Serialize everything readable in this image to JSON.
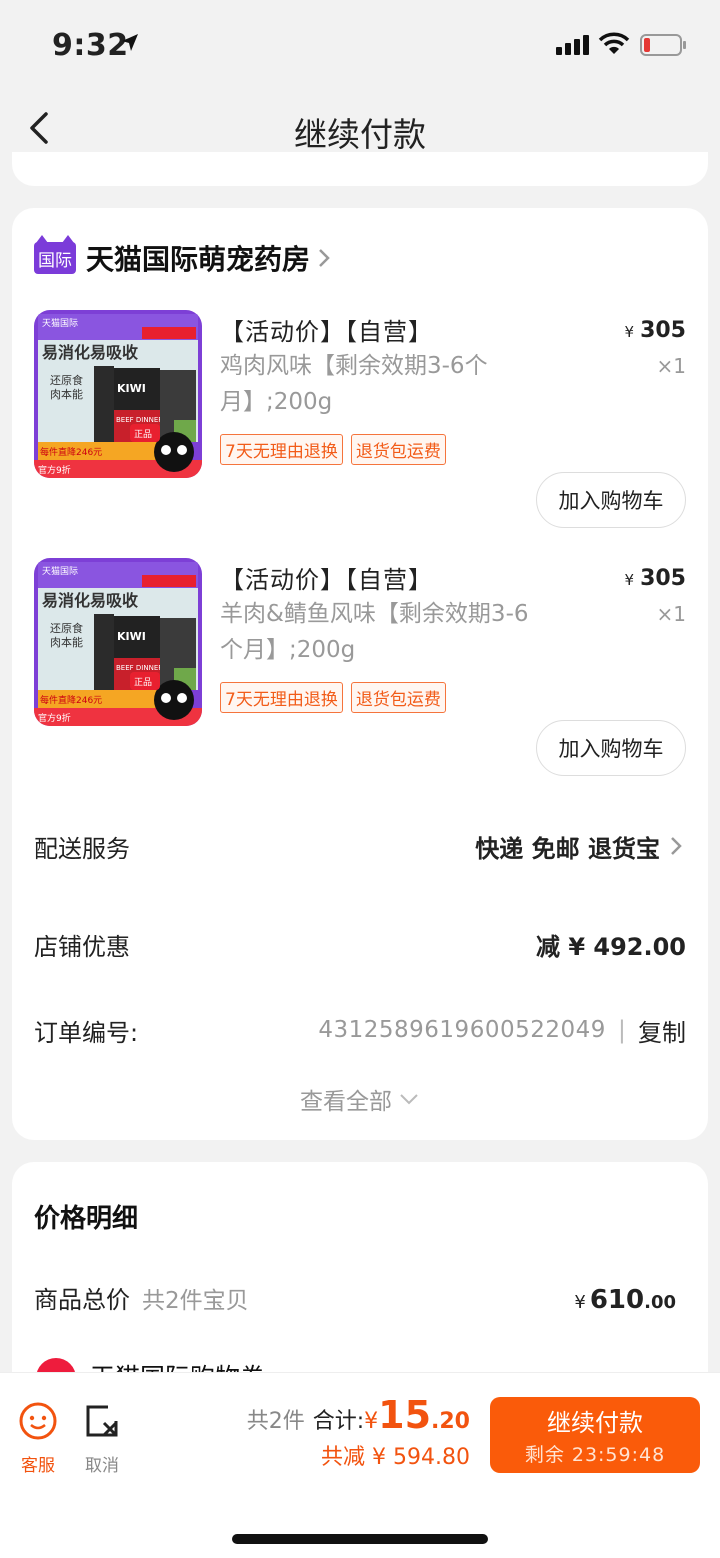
{
  "status": {
    "time": "9:32",
    "battery_color": "#e53935"
  },
  "nav": {
    "title": "继续付款",
    "back_icon": "chevron-left-icon"
  },
  "store": {
    "badge": "国际",
    "name": "天猫国际萌宠药房",
    "badge_color": "#7b3bd9",
    "products": [
      {
        "tags": "【活动价】【自营】",
        "desc": "鸡肉风味【剩余效期3-6个月】;200g",
        "yen": "¥",
        "price": "305",
        "qty": "×1",
        "badge1": "7天无理由退换",
        "badge2": "退货包运费",
        "cart_label": "加入购物车",
        "image_text": {
          "top": "天猫国际",
          "title": "易消化易吸收",
          "sub1": "还原食",
          "sub2": "肉本能",
          "brand": "KIWI",
          "pack": "BEEF DINNER",
          "seal": "正品",
          "promo": "每件直降246元",
          "promo2": "官方9折"
        }
      },
      {
        "tags": "【活动价】【自营】",
        "desc": "羊肉&鲭鱼风味【剩余效期3-6个月】;200g",
        "yen": "¥",
        "price": "305",
        "qty": "×1",
        "badge1": "7天无理由退换",
        "badge2": "退货包运费",
        "cart_label": "加入购物车",
        "image_text": {
          "top": "天猫国际",
          "title": "易消化易吸收",
          "sub1": "还原食",
          "sub2": "肉本能",
          "brand": "KIWI",
          "pack": "BEEF DINNER",
          "seal": "正品",
          "promo": "每件直降246元",
          "promo2": "官方9折"
        }
      }
    ],
    "delivery": {
      "label": "配送服务",
      "value": "快递 免邮 退货宝"
    },
    "discount": {
      "label": "店铺优惠",
      "value": "减 ¥ 492.00"
    },
    "order": {
      "label": "订单编号:",
      "number": "4312589619600522049",
      "sep": "|",
      "copy": "复制"
    },
    "view_all": "查看全部"
  },
  "price_detail": {
    "title": "价格明细",
    "total_label": "商品总价",
    "total_sub": "共2件宝贝",
    "total_yen": "¥",
    "total_int": "610",
    "total_dec": ".00",
    "coupon_label": "天猫国际购物券"
  },
  "bottom": {
    "service_label": "客服",
    "cancel_label": "取消",
    "count": "共2件",
    "sum_label": "合计:",
    "sum_yen": "¥",
    "sum_int": "15",
    "sum_dec": ".20",
    "saved": "共减 ¥ 594.80",
    "pay_label": "继续付款",
    "timer": "剩余 23:59:48",
    "accent": "#fa5b0a"
  }
}
